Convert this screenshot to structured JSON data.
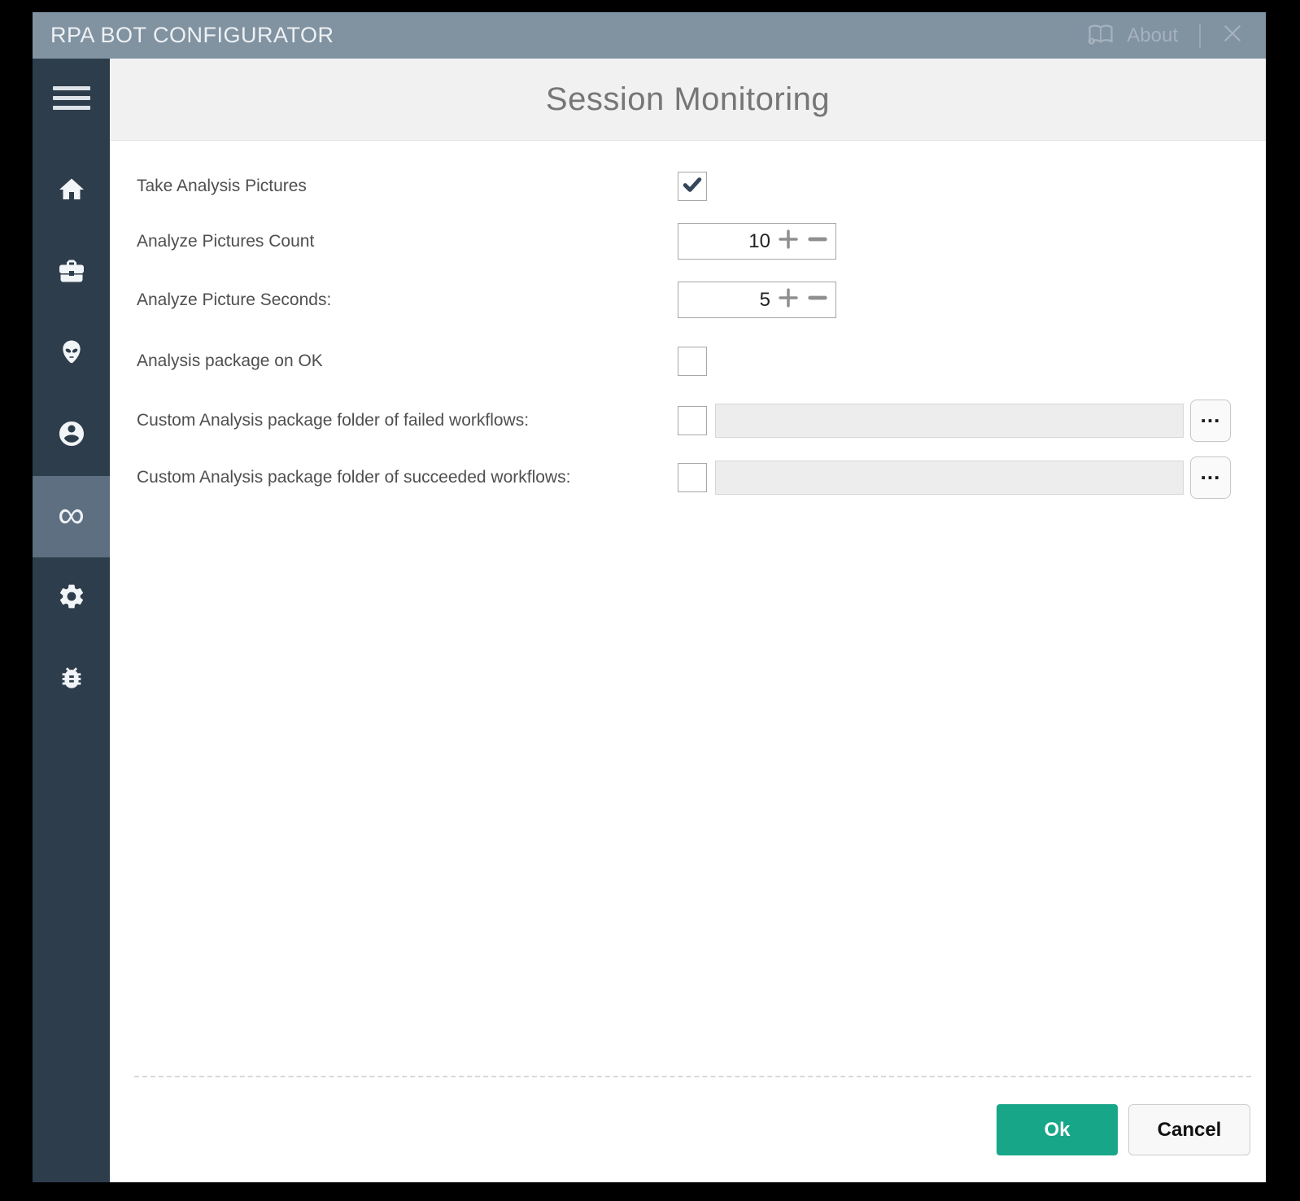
{
  "titlebar": {
    "title": "RPA BOT CONFIGURATOR",
    "about_label": "About",
    "icons": {
      "manual": "open-book-icon",
      "close": "close-x-icon"
    }
  },
  "sidebar": {
    "infinity_char": "∞",
    "items": [
      {
        "name": "menu",
        "icon": "hamburger-icon",
        "active": false
      },
      {
        "name": "home",
        "icon": "home-icon",
        "active": false
      },
      {
        "name": "jobs",
        "icon": "briefcase-icon",
        "active": false
      },
      {
        "name": "bots",
        "icon": "alien-icon",
        "active": false
      },
      {
        "name": "user",
        "icon": "person-icon",
        "active": false
      },
      {
        "name": "session-monitoring",
        "icon": "infinity-icon",
        "active": true
      },
      {
        "name": "settings",
        "icon": "gear-icon",
        "active": false
      },
      {
        "name": "debug",
        "icon": "bug-icon",
        "active": false
      }
    ]
  },
  "header": {
    "title": "Session Monitoring"
  },
  "form": {
    "take_pictures": {
      "label": "Take Analysis Pictures",
      "checked": true
    },
    "pictures_count": {
      "label": "Analyze Pictures Count",
      "value": "10"
    },
    "picture_seconds": {
      "label": "Analyze Picture Seconds:",
      "value": "5"
    },
    "package_on_ok": {
      "label": "Analysis package on OK",
      "checked": false
    },
    "failed_folder": {
      "label": "Custom Analysis package folder of failed workflows:",
      "checked": false,
      "value": "",
      "browse_label": "..."
    },
    "succeeded_folder": {
      "label": "Custom Analysis package folder of succeeded workflows:",
      "checked": false,
      "value": "",
      "browse_label": "..."
    }
  },
  "footer": {
    "ok_label": "Ok",
    "cancel_label": "Cancel"
  },
  "colors": {
    "titlebar": "#8192A1",
    "sidebar": "#2E3D4C",
    "sidebar_active": "#5D6F80",
    "header_bg": "#F1F1F1",
    "accent_teal": "#18A689",
    "checkmark": "#36465A"
  }
}
